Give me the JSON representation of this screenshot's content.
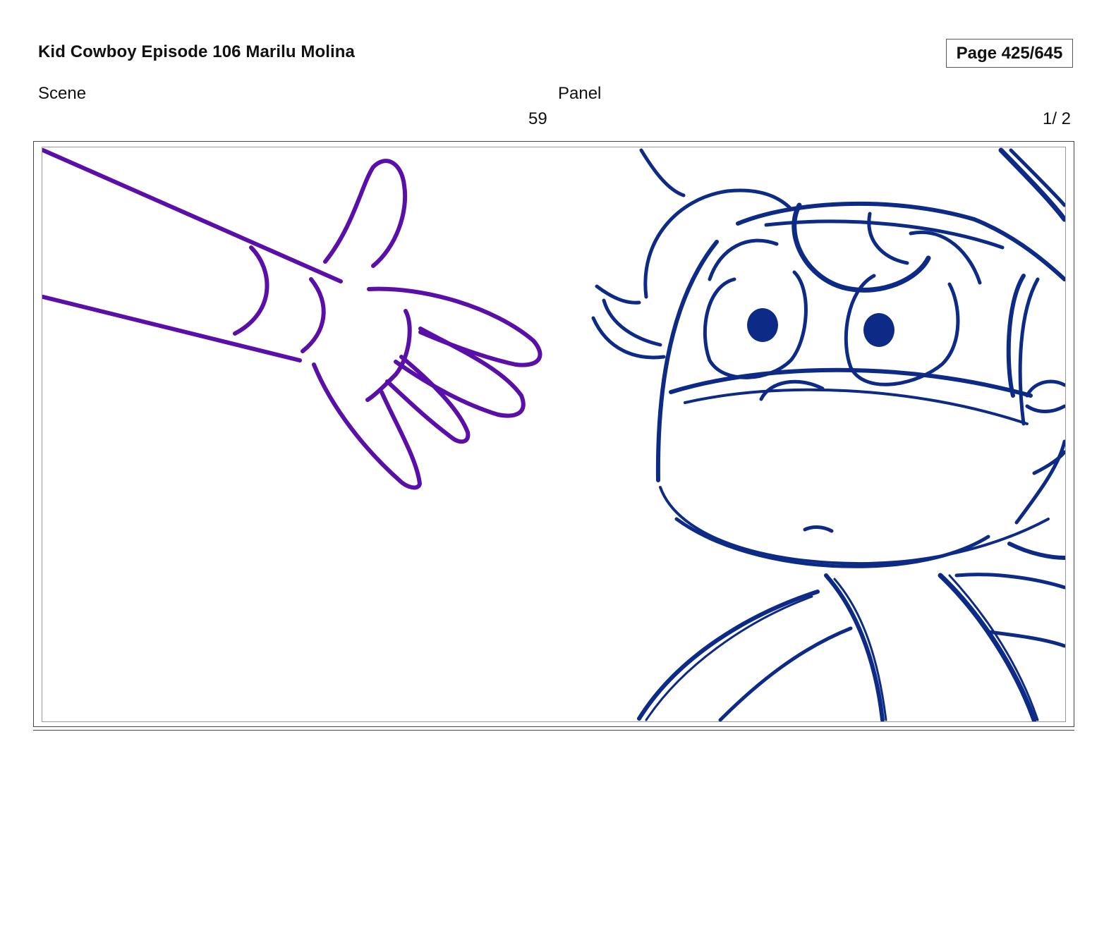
{
  "header": {
    "title": "Kid Cowboy Episode 106 Marilu Molina",
    "page_label": "Page 425/645"
  },
  "info": {
    "scene_label": "Scene",
    "scene_value": "59",
    "panel_label": "Panel",
    "panel_value": "1/ 2"
  },
  "panel": {
    "artwork_name": "storyboard-sketch",
    "colors": {
      "hand": "#5a0fa8",
      "character": "#0d2a86"
    }
  }
}
